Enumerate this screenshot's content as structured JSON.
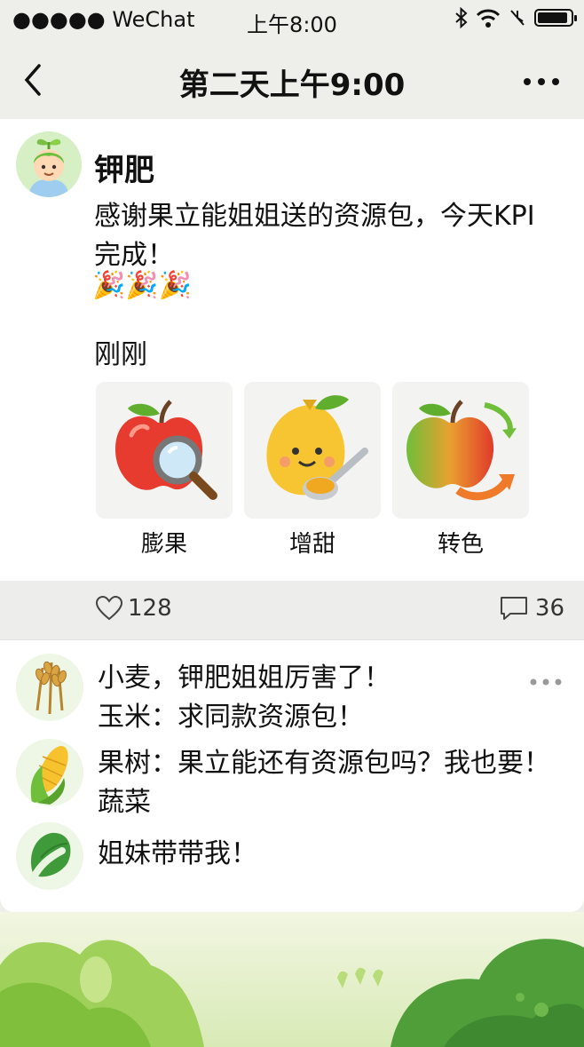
{
  "status_bar": {
    "carrier": "●●●●● WeChat",
    "time": "上午8:00"
  },
  "nav": {
    "back_label": "<",
    "title": "第二天上午9:00",
    "more_label": "•••"
  },
  "post": {
    "username": "钾肥",
    "content": "感谢果立能姐姐送的资源包，今天KPI完成！",
    "emojis": "🎉🎉🎉",
    "time_ago": "刚刚",
    "packs": [
      {
        "label": "膨果",
        "icon": "apple-magnifier-icon"
      },
      {
        "label": "增甜",
        "icon": "lemon-spoon-icon"
      },
      {
        "label": "转色",
        "icon": "apple-color-change-icon"
      }
    ],
    "likes": "128",
    "comments_count": "36"
  },
  "comments": [
    {
      "avatar": "wheat-icon",
      "text": "小麦，钾肥姐姐厉害了！"
    },
    {
      "avatar": "",
      "text": "玉米：求同款资源包！"
    },
    {
      "avatar": "corn-icon",
      "text": "果树：果立能还有资源包吗？我也要！"
    },
    {
      "avatar": "",
      "text": "蔬菜"
    },
    {
      "avatar": "cabbage-icon",
      "text": "姐妹带带我！"
    }
  ],
  "colors": {
    "accent_green": "#8bc34a",
    "card_bg": "#ffffff",
    "page_bg": "#eeeeea"
  }
}
